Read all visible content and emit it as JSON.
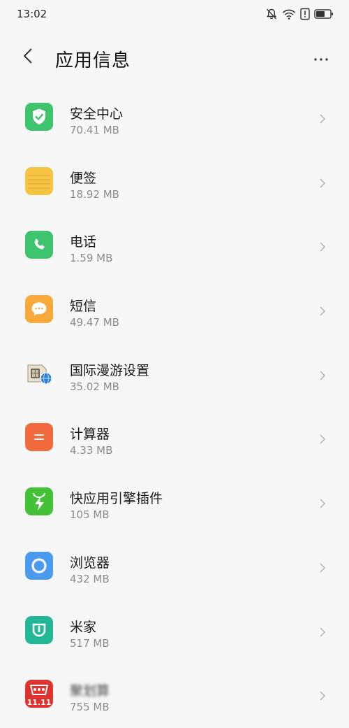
{
  "status_bar": {
    "time": "13:02",
    "icons": [
      "bell-off-icon",
      "wifi-icon",
      "alert-sim-icon",
      "battery-icon"
    ]
  },
  "header": {
    "title": "应用信息",
    "back_icon": "chevron-left-icon",
    "more_icon": "more-dots-icon"
  },
  "apps": [
    {
      "name": "安全中心",
      "size": "70.41 MB",
      "icon": "shield-check-icon",
      "color": "#3fc46e"
    },
    {
      "name": "便签",
      "size": "18.92 MB",
      "icon": "notes-icon",
      "color": "#f5c443"
    },
    {
      "name": "电话",
      "size": "1.59 MB",
      "icon": "phone-icon",
      "color": "#3fc46e"
    },
    {
      "name": "短信",
      "size": "49.47 MB",
      "icon": "message-icon",
      "color": "#f7a93b"
    },
    {
      "name": "国际漫游设置",
      "size": "35.02 MB",
      "icon": "roaming-sim-icon",
      "color": "#eeeeee"
    },
    {
      "name": "计算器",
      "size": "4.33 MB",
      "icon": "calculator-icon",
      "color": "#f26a3c"
    },
    {
      "name": "快应用引擎插件",
      "size": "105 MB",
      "icon": "quick-app-bolt-icon",
      "color": "#44c237"
    },
    {
      "name": "浏览器",
      "size": "432 MB",
      "icon": "browser-ring-icon",
      "color": "#4a9bf0"
    },
    {
      "name": "米家",
      "size": "517 MB",
      "icon": "mijia-icon",
      "color": "#22b897"
    },
    {
      "name": "聚划算",
      "size": "755 MB",
      "icon": "shopping-11-11-icon",
      "color": "#e0322e",
      "badge": "11.11"
    }
  ]
}
